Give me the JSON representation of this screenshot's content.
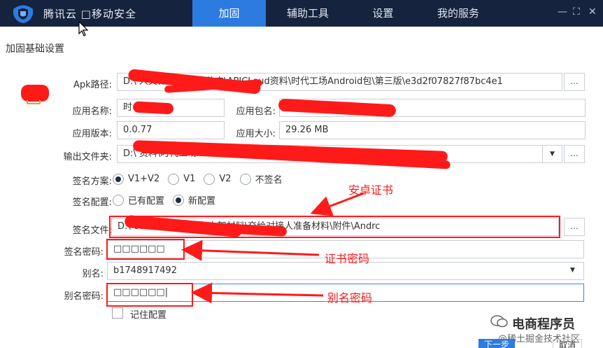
{
  "titlebar": {
    "title": "腾讯云 □移动安全",
    "tabs": [
      {
        "label": "加固",
        "active": true
      },
      {
        "label": "辅助工具",
        "active": false
      },
      {
        "label": "设置",
        "active": false
      },
      {
        "label": "我的服务",
        "active": false
      }
    ],
    "controls": {
      "minimize": "—",
      "restore": "⛶",
      "close": "✕"
    }
  },
  "section_title": "加固基础设置",
  "form": {
    "apk_path": {
      "label": "Apk路径:",
      "value": "D:\\      人文件夹\\个人文件夹\\APICLoud资料\\时代工场Android包\\第三版\\e3d2f07827f87bc4e1",
      "browse": "..."
    },
    "app_name": {
      "label": "应用名称:",
      "value": "时"
    },
    "package_name": {
      "label": "应用包名:",
      "value": ""
    },
    "version": {
      "label": "应用版本:",
      "value": "0.0.77"
    },
    "size": {
      "label": "应用大小:",
      "value": "29.26 MB"
    },
    "output_folder": {
      "label": "输出文件夹:",
      "value": "D:\\                                              资料\\时代工场Android包\\第三版"
    },
    "sign_scheme": {
      "label": "签名方案:",
      "options": [
        "V1+V2",
        "V1",
        "V2",
        "不签名"
      ],
      "selected": "V1+V2"
    },
    "sign_config": {
      "label": "签名配置:",
      "options": [
        "已有配置",
        "新配置"
      ],
      "selected": "新配置"
    },
    "sign_file": {
      "label": "签名文件:",
      "value": "D:\\                           oud资料\\渠道打包上架材料\\交给对接人准备材料\\附件\\Andrc",
      "browse": "..."
    },
    "sign_password": {
      "label": "签名密码:",
      "value": "□□□□□□"
    },
    "alias": {
      "label": "别名:",
      "value": "b1748917492"
    },
    "alias_password": {
      "label": "别名密码:",
      "value": "□□□□□□|"
    },
    "remember": {
      "label": "记住配置"
    }
  },
  "annotations": {
    "cert": "安卓证书",
    "cert_password": "证书密码",
    "alias_password": "别名密码"
  },
  "watermark": {
    "name": "电商程序员",
    "sub": "@稀土掘金技术社区"
  },
  "bottom_buttons": {
    "next": "下一步",
    "cancel": "取消"
  },
  "colors": {
    "titlebar": "#16233e",
    "active_tab": "#2c7be0",
    "annotation": "#ff1a1a"
  }
}
